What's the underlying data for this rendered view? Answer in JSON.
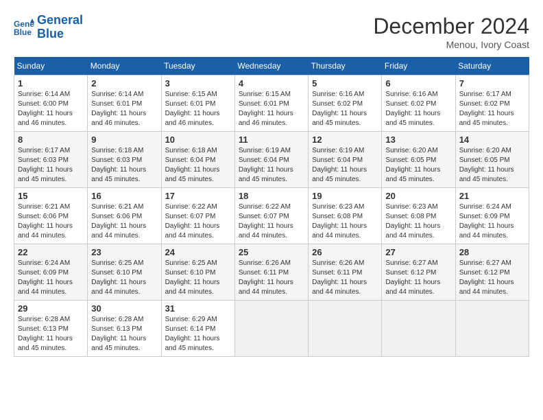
{
  "logo": {
    "line1": "General",
    "line2": "Blue"
  },
  "title": "December 2024",
  "location": "Menou, Ivory Coast",
  "days_of_week": [
    "Sunday",
    "Monday",
    "Tuesday",
    "Wednesday",
    "Thursday",
    "Friday",
    "Saturday"
  ],
  "weeks": [
    [
      {
        "day": "1",
        "sunrise": "6:14 AM",
        "sunset": "6:00 PM",
        "daylight": "11 hours and 46 minutes."
      },
      {
        "day": "2",
        "sunrise": "6:14 AM",
        "sunset": "6:01 PM",
        "daylight": "11 hours and 46 minutes."
      },
      {
        "day": "3",
        "sunrise": "6:15 AM",
        "sunset": "6:01 PM",
        "daylight": "11 hours and 46 minutes."
      },
      {
        "day": "4",
        "sunrise": "6:15 AM",
        "sunset": "6:01 PM",
        "daylight": "11 hours and 46 minutes."
      },
      {
        "day": "5",
        "sunrise": "6:16 AM",
        "sunset": "6:02 PM",
        "daylight": "11 hours and 45 minutes."
      },
      {
        "day": "6",
        "sunrise": "6:16 AM",
        "sunset": "6:02 PM",
        "daylight": "11 hours and 45 minutes."
      },
      {
        "day": "7",
        "sunrise": "6:17 AM",
        "sunset": "6:02 PM",
        "daylight": "11 hours and 45 minutes."
      }
    ],
    [
      {
        "day": "8",
        "sunrise": "6:17 AM",
        "sunset": "6:03 PM",
        "daylight": "11 hours and 45 minutes."
      },
      {
        "day": "9",
        "sunrise": "6:18 AM",
        "sunset": "6:03 PM",
        "daylight": "11 hours and 45 minutes."
      },
      {
        "day": "10",
        "sunrise": "6:18 AM",
        "sunset": "6:04 PM",
        "daylight": "11 hours and 45 minutes."
      },
      {
        "day": "11",
        "sunrise": "6:19 AM",
        "sunset": "6:04 PM",
        "daylight": "11 hours and 45 minutes."
      },
      {
        "day": "12",
        "sunrise": "6:19 AM",
        "sunset": "6:04 PM",
        "daylight": "11 hours and 45 minutes."
      },
      {
        "day": "13",
        "sunrise": "6:20 AM",
        "sunset": "6:05 PM",
        "daylight": "11 hours and 45 minutes."
      },
      {
        "day": "14",
        "sunrise": "6:20 AM",
        "sunset": "6:05 PM",
        "daylight": "11 hours and 45 minutes."
      }
    ],
    [
      {
        "day": "15",
        "sunrise": "6:21 AM",
        "sunset": "6:06 PM",
        "daylight": "11 hours and 44 minutes."
      },
      {
        "day": "16",
        "sunrise": "6:21 AM",
        "sunset": "6:06 PM",
        "daylight": "11 hours and 44 minutes."
      },
      {
        "day": "17",
        "sunrise": "6:22 AM",
        "sunset": "6:07 PM",
        "daylight": "11 hours and 44 minutes."
      },
      {
        "day": "18",
        "sunrise": "6:22 AM",
        "sunset": "6:07 PM",
        "daylight": "11 hours and 44 minutes."
      },
      {
        "day": "19",
        "sunrise": "6:23 AM",
        "sunset": "6:08 PM",
        "daylight": "11 hours and 44 minutes."
      },
      {
        "day": "20",
        "sunrise": "6:23 AM",
        "sunset": "6:08 PM",
        "daylight": "11 hours and 44 minutes."
      },
      {
        "day": "21",
        "sunrise": "6:24 AM",
        "sunset": "6:09 PM",
        "daylight": "11 hours and 44 minutes."
      }
    ],
    [
      {
        "day": "22",
        "sunrise": "6:24 AM",
        "sunset": "6:09 PM",
        "daylight": "11 hours and 44 minutes."
      },
      {
        "day": "23",
        "sunrise": "6:25 AM",
        "sunset": "6:10 PM",
        "daylight": "11 hours and 44 minutes."
      },
      {
        "day": "24",
        "sunrise": "6:25 AM",
        "sunset": "6:10 PM",
        "daylight": "11 hours and 44 minutes."
      },
      {
        "day": "25",
        "sunrise": "6:26 AM",
        "sunset": "6:11 PM",
        "daylight": "11 hours and 44 minutes."
      },
      {
        "day": "26",
        "sunrise": "6:26 AM",
        "sunset": "6:11 PM",
        "daylight": "11 hours and 44 minutes."
      },
      {
        "day": "27",
        "sunrise": "6:27 AM",
        "sunset": "6:12 PM",
        "daylight": "11 hours and 44 minutes."
      },
      {
        "day": "28",
        "sunrise": "6:27 AM",
        "sunset": "6:12 PM",
        "daylight": "11 hours and 44 minutes."
      }
    ],
    [
      {
        "day": "29",
        "sunrise": "6:28 AM",
        "sunset": "6:13 PM",
        "daylight": "11 hours and 45 minutes."
      },
      {
        "day": "30",
        "sunrise": "6:28 AM",
        "sunset": "6:13 PM",
        "daylight": "11 hours and 45 minutes."
      },
      {
        "day": "31",
        "sunrise": "6:29 AM",
        "sunset": "6:14 PM",
        "daylight": "11 hours and 45 minutes."
      },
      null,
      null,
      null,
      null
    ]
  ]
}
